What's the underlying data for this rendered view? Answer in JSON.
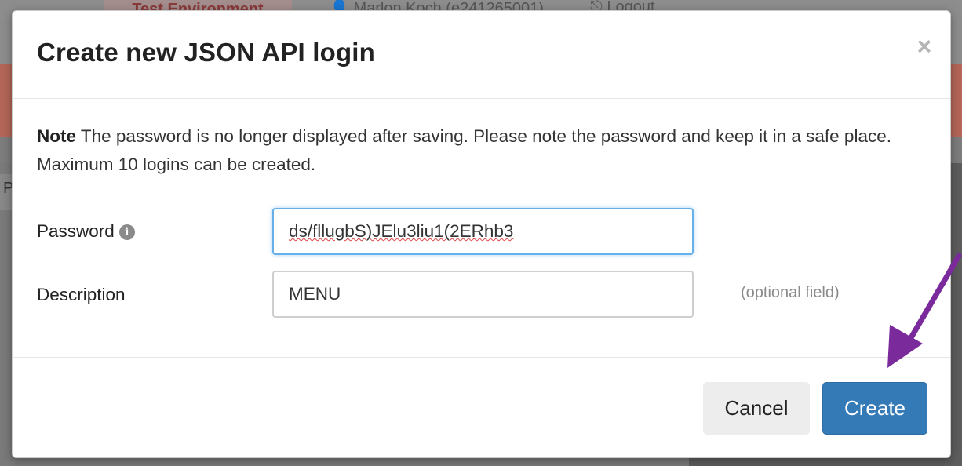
{
  "background": {
    "environment_badge": "Test Environment",
    "user": "Marlon Koch (e241265001)",
    "logout": "Logout",
    "row_partial": "P"
  },
  "dialog": {
    "title": "Create new JSON API login",
    "close_symbol": "×",
    "note": {
      "bold": "Note",
      "text": " The password is no longer displayed after saving. Please note the password and keep it in a safe place. Maximum 10 logins can be created."
    },
    "fields": {
      "password": {
        "label": "Password",
        "info_icon_glyph": "i",
        "value": "ds/fllugbS)JElu3liu1(2ERhb3",
        "focused": true
      },
      "description": {
        "label": "Description",
        "value": "MENU",
        "hint": "(optional field)"
      }
    },
    "buttons": {
      "cancel": "Cancel",
      "create": "Create"
    }
  },
  "colors": {
    "primary": "#337ab7",
    "annotation_arrow": "#7b2a9c",
    "focus_border": "#66afe9"
  },
  "icons": {
    "close": "close-icon",
    "info": "info-circle-icon",
    "annotation": "arrow-pointer-annotation"
  }
}
